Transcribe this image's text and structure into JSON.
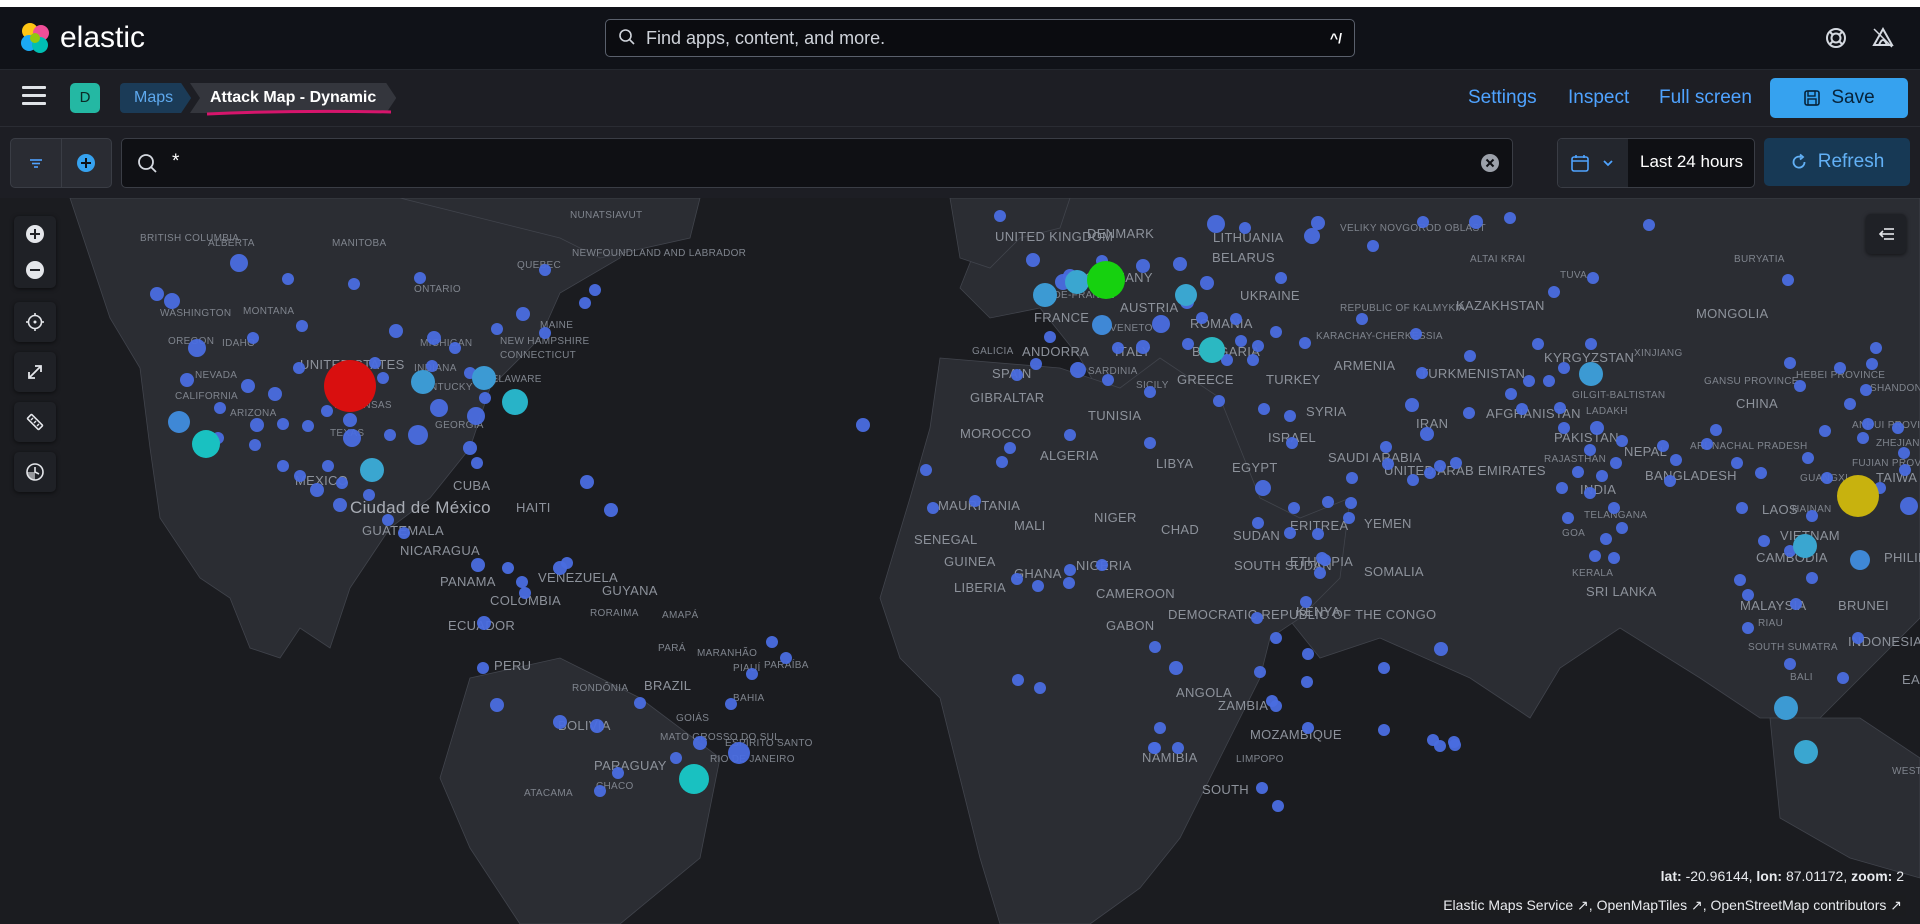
{
  "header": {
    "app_name": "elastic",
    "search_placeholder": "Find apps, content, and more.",
    "search_shortcut": "^/",
    "brand_colors": [
      "#f04e98",
      "#fec514",
      "#00bfb3",
      "#1ba9f5"
    ]
  },
  "nav": {
    "avatar_initial": "D",
    "breadcrumbs": [
      "Maps",
      "Attack Map - Dynamic"
    ],
    "links": [
      "Settings",
      "Inspect",
      "Full screen"
    ],
    "save_label": "Save",
    "accent": "#36a2ef"
  },
  "query": {
    "value": "*",
    "date_range": "Last 24 hours",
    "refresh_label": "Refresh"
  },
  "map": {
    "coordinates_label": {
      "lat_key": "lat:",
      "lat": "-20.96144",
      "lon_key": "lon:",
      "lon": "87.01172",
      "zoom_key": "zoom:",
      "zoom": "2"
    },
    "attribution": [
      "Elastic Maps Service",
      "OpenMapTiles",
      "OpenStreetMap contributors"
    ],
    "labels": {
      "british_columbia": "BRITISH COLUMBIA",
      "alberta": "ALBERTA",
      "manitoba": "MANITOBA",
      "nunatsiavut": "NUNATSIAVUT",
      "newfoundland": "NEWFOUNDLAND AND LABRADOR",
      "quebec": "QUEBEC",
      "ontario": "ONTARIO",
      "washington": "WASHINGTON",
      "montana": "MONTANA",
      "oregon": "OREGON",
      "idaho": "IDAHO",
      "nevada": "NEVADA",
      "california": "CALIFORNIA",
      "arizona": "ARIZONA",
      "united_states": "UNITED STATES",
      "michigan": "MICHIGAN",
      "indiana": "INDIANA",
      "kentucky": "KENTUCKY",
      "maine": "MAINE",
      "new_hampshire": "NEW HAMPSHIRE",
      "connecticut": "CONNECTICUT",
      "delaware": "DELAWARE",
      "arkansas": "ARKANSAS",
      "texas": "TEXAS",
      "georgia": "GEORGIA",
      "mexico": "MEXICO",
      "cuba": "CUBA",
      "ciudad_de_mexico": "Ciudad de México",
      "haiti": "HAITI",
      "guatemala": "GUATEMALA",
      "nicaragua": "NICARAGUA",
      "panama": "PANAMA",
      "venezuela": "VENEZUELA",
      "colombia": "COLOMBIA",
      "guyana": "GUYANA",
      "roraima": "RORAIMA",
      "amapa": "AMAPÁ",
      "ecuador": "ECUADOR",
      "peru": "PERU",
      "para": "PARÁ",
      "maranhao": "MARANHÃO",
      "piaui": "PIAUÍ",
      "paraiba": "PARAÍBA",
      "brazil": "BRAZIL",
      "rondonia": "RONDÔNIA",
      "bahia": "BAHIA",
      "bolivia": "BOLIVIA",
      "goias": "GOIÁS",
      "mato_grosso": "MATO GROSSO DO SUL",
      "espirito_santo": "ESPÍRITO SANTO",
      "rio_de_janeiro": "RIO DE JANEIRO",
      "paraguay": "PARAGUAY",
      "chaco": "CHACO",
      "atacama": "ATACAMA",
      "united_kingdom": "UNITED KINGDOM",
      "denmark": "DENMARK",
      "lithuania": "LITHUANIA",
      "belarus": "BELARUS",
      "germany": "GERMANY",
      "ile_de_france": "ÎLE-DE-FRANCE",
      "france": "FRANCE",
      "austria": "AUSTRIA",
      "ukraine": "UKRAINE",
      "romania": "ROMANIA",
      "veneto": "VENETO",
      "andorra": "ANDORRA",
      "italy": "ITALY",
      "bulgaria": "BULGARIA",
      "galicia": "GALICIA",
      "spain": "SPAIN",
      "sardinia": "SARDINIA",
      "sicily": "SICILY",
      "greece": "GREECE",
      "turkey": "TURKEY",
      "gibraltar": "GIBRALTAR",
      "tunisia": "TUNISIA",
      "morocco": "MOROCCO",
      "algeria": "ALGERIA",
      "libya": "LIBYA",
      "egypt": "EGYPT",
      "mauritania": "MAURITANIA",
      "mali": "MALI",
      "niger": "NIGER",
      "chad": "CHAD",
      "sudan": "SUDAN",
      "eritrea": "ERITREA",
      "yemen": "YEMEN",
      "senegal": "SENEGAL",
      "guinea": "GUINEA",
      "nigeria": "NIGERIA",
      "ethiopia": "ETHIOPIA",
      "south_sudan": "SOUTH SUDAN",
      "somalia": "SOMALIA",
      "liberia": "LIBERIA",
      "ghana": "GHANA",
      "cameroon": "CAMEROON",
      "gabon": "GABON",
      "drc": "DEMOCRATIC REPUBLIC OF THE CONGO",
      "kenya": "KENYA",
      "angola": "ANGOLA",
      "zambia": "ZAMBIA",
      "mozambique": "MOZAMBIQUE",
      "namibia": "NAMIBIA",
      "limpopo": "LIMPOPO",
      "south": "SOUTH",
      "veliky_novgorod": "VELIKY NOVGOROD OBLAST",
      "altai_krai": "ALTAI KRAI",
      "tuva": "TUVA",
      "buryatia": "BURYATIA",
      "kalmykia": "REPUBLIC OF KALMYKIA",
      "karachay": "KARACHAY-CHERKESSIA",
      "armenia": "ARMENIA",
      "kazakhstan": "KAZAKHSTAN",
      "mongolia": "MONGOLIA",
      "kyrgyzstan": "KYRGYZSTAN",
      "xinjiang": "XINJIANG",
      "turkmenistan": "TURKMENISTAN",
      "syria": "SYRIA",
      "israel": "ISRAEL",
      "iran": "IRAN",
      "afghanistan": "AFGHANISTAN",
      "gilgit": "GILGIT-BALTISTAN",
      "ladakh": "LADAKH",
      "pakistan": "PAKISTAN",
      "saudi_arabia": "SAUDI ARABIA",
      "uae": "UNITED ARAB EMIRATES",
      "rajasthan": "RAJASTHAN",
      "nepal": "NEPAL",
      "arunachal": "ARUNACHAL PRADESH",
      "india": "INDIA",
      "bangladesh": "BANGLADESH",
      "telangana": "TELANGANA",
      "goa": "GOA",
      "kerala": "KERALA",
      "sri_lanka": "SRI LANKA",
      "gansu": "GANSU PROVINCE",
      "hebei": "HEBEI PROVINCE",
      "shandong": "SHANDONG PROVINCE",
      "china": "CHINA",
      "anhui": "ANHUI PROVINCE",
      "zhejiang": "ZHEJIANG",
      "fujian": "FUJIAN PROVINCE",
      "guangxi": "GUANGXI",
      "taiwan": "TAIWA",
      "laos": "LAOS",
      "hainan": "HAINAN",
      "vietnam": "VIETNAM",
      "cambodia": "CAMBODIA",
      "philippines": "PHILIP",
      "malaysia": "MALAYSIA",
      "brunei": "BRUNEI",
      "riau": "RIAU",
      "south_sumatra": "SOUTH SUMATRA",
      "indonesia": "INDONESIA",
      "bali": "BALI",
      "east": "EA",
      "western": "WESTER"
    }
  }
}
